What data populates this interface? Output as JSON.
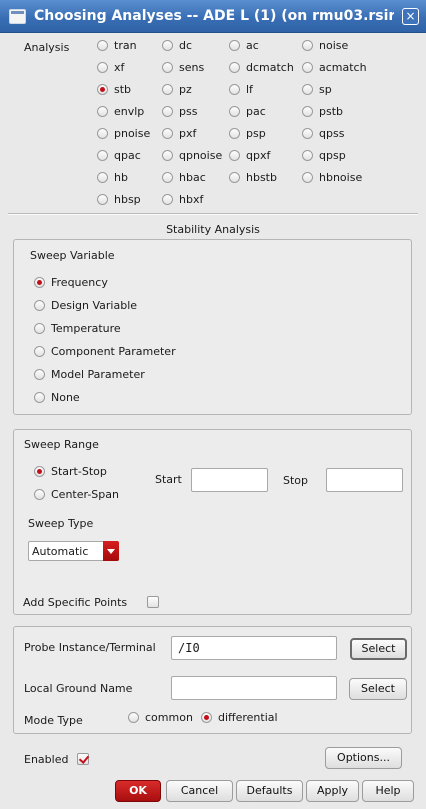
{
  "window": {
    "title": "Choosing Analyses -- ADE L (1) (on rmu03.rsir",
    "close_glyph": "×",
    "app_icon": "window-icon",
    "close_icon": "close-icon"
  },
  "analysis": {
    "label": "Analysis",
    "selected": "stb",
    "rows": [
      [
        "tran",
        "dc",
        "ac",
        "noise"
      ],
      [
        "xf",
        "sens",
        "dcmatch",
        "acmatch"
      ],
      [
        "stb",
        "pz",
        "lf",
        "sp"
      ],
      [
        "envlp",
        "pss",
        "pac",
        "pstb"
      ],
      [
        "pnoise",
        "pxf",
        "psp",
        "qpss"
      ],
      [
        "qpac",
        "qpnoise",
        "qpxf",
        "qpsp"
      ],
      [
        "hb",
        "hbac",
        "hbstb",
        "hbnoise"
      ],
      [
        "hbsp",
        "hbxf"
      ]
    ]
  },
  "section_title": "Stability Analysis",
  "sweep_variable": {
    "label": "Sweep Variable",
    "selected": "Frequency",
    "options": [
      "Frequency",
      "Design Variable",
      "Temperature",
      "Component Parameter",
      "Model Parameter",
      "None"
    ]
  },
  "sweep_range": {
    "label": "Sweep Range",
    "options": [
      "Start-Stop",
      "Center-Span"
    ],
    "selected": "Start-Stop",
    "start_label": "Start",
    "start_value": "",
    "stop_label": "Stop",
    "stop_value": "",
    "sweep_type_label": "Sweep Type",
    "sweep_type_value": "Automatic",
    "add_points_label": "Add Specific Points",
    "add_points_checked": false
  },
  "probe": {
    "instance_label": "Probe Instance/Terminal",
    "instance_value": "/I0",
    "select_label": "Select",
    "ground_label": "Local Ground Name",
    "ground_value": "",
    "ground_select_label": "Select",
    "mode_label": "Mode Type",
    "mode_options": [
      "common",
      "differential"
    ],
    "mode_selected": "differential"
  },
  "footer": {
    "enabled_label": "Enabled",
    "enabled_checked": true,
    "options_label": "Options...",
    "ok_label": "OK",
    "cancel_label": "Cancel",
    "defaults_label": "Defaults",
    "apply_label": "Apply",
    "help_label": "Help"
  },
  "colors": {
    "titlebar": "#3a6fb5",
    "accent_red": "#c2101a",
    "background": "#e9e9e9"
  }
}
